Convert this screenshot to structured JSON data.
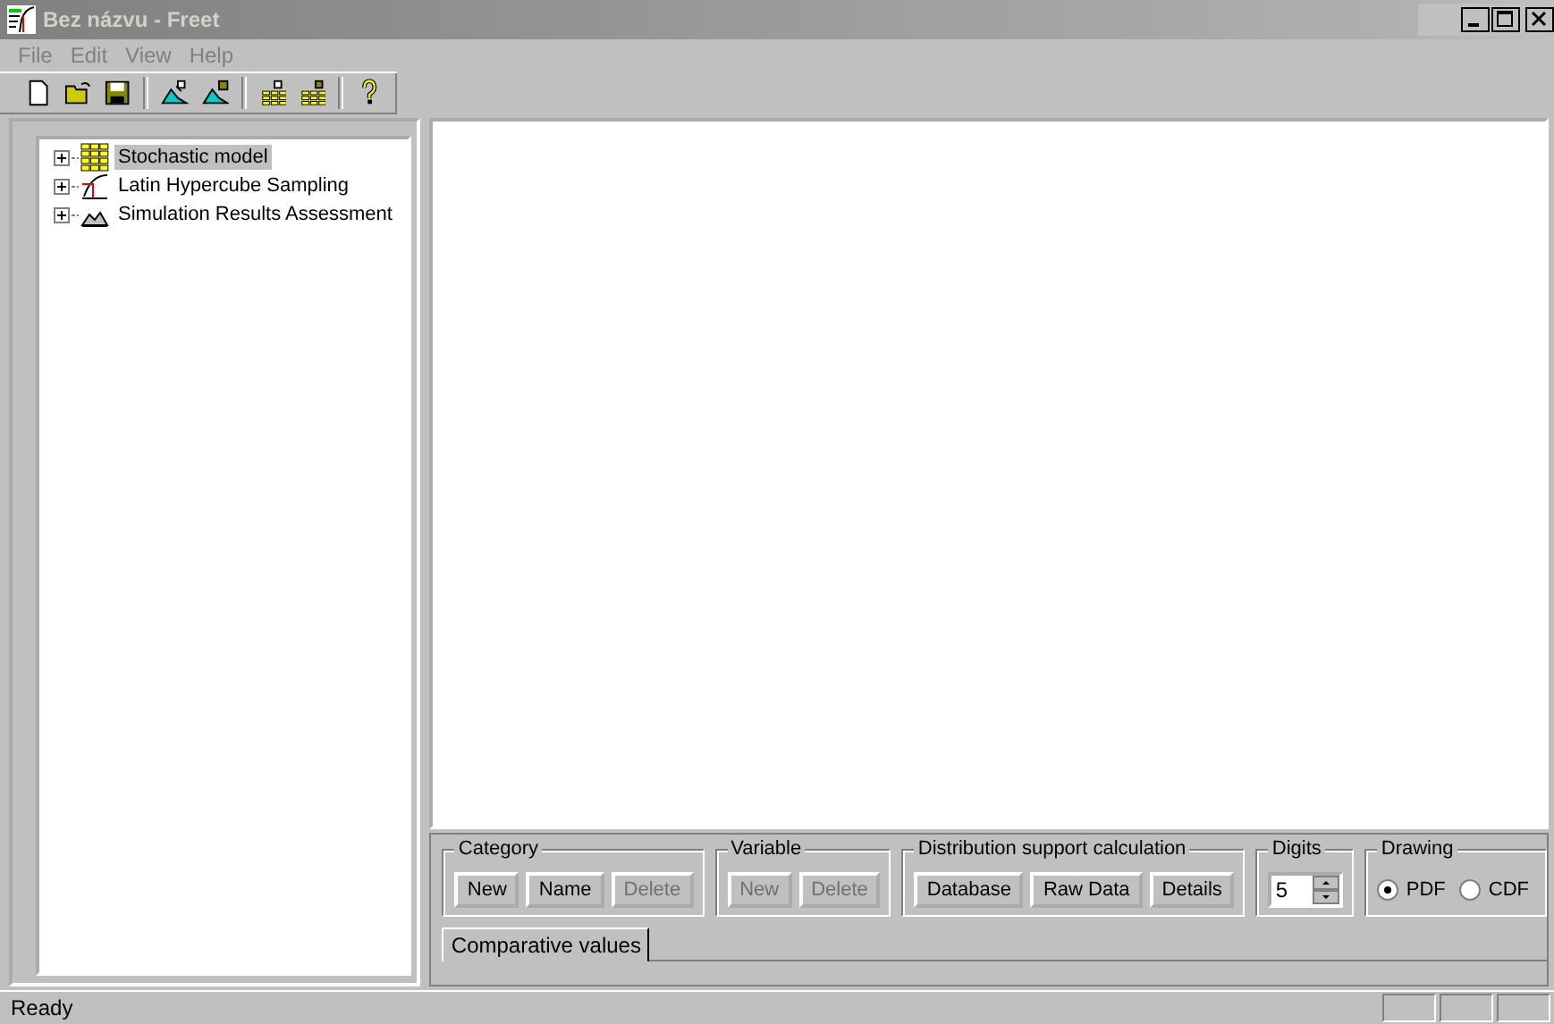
{
  "window": {
    "title": "Bez názvu - Freet"
  },
  "menu": [
    "File",
    "Edit",
    "View",
    "Help"
  ],
  "tree": [
    {
      "label": "Stochastic model",
      "kind": "model",
      "selected": true,
      "expanded": false
    },
    {
      "label": "Latin Hypercube Sampling",
      "kind": "sampling",
      "selected": false,
      "expanded": false
    },
    {
      "label": "Simulation Results Assessment",
      "kind": "assessment",
      "selected": false,
      "expanded": false
    }
  ],
  "groups": [
    {
      "kind": "buttons",
      "title": "Category",
      "buttons": [
        {
          "label": "New",
          "disabled": false
        },
        {
          "label": "Name",
          "disabled": false
        },
        {
          "label": "Delete",
          "disabled": true
        }
      ]
    },
    {
      "kind": "buttons",
      "title": "Variable",
      "buttons": [
        {
          "label": "New",
          "disabled": true
        },
        {
          "label": "Delete",
          "disabled": true
        }
      ]
    },
    {
      "kind": "buttons",
      "title": "Distribution support calculation",
      "buttons": [
        {
          "label": "Database",
          "disabled": false
        },
        {
          "label": "Raw Data",
          "disabled": false
        },
        {
          "label": "Details",
          "disabled": false
        }
      ]
    },
    {
      "kind": "spinner",
      "title": "Digits",
      "value": "5"
    },
    {
      "kind": "radio",
      "title": "Drawing",
      "options": [
        {
          "label": "PDF",
          "selected": true
        },
        {
          "label": "CDF",
          "selected": false
        }
      ]
    }
  ],
  "tabs": [
    {
      "label": "Comparative values",
      "selected": true
    }
  ],
  "status_bar": {
    "text": "Ready"
  }
}
